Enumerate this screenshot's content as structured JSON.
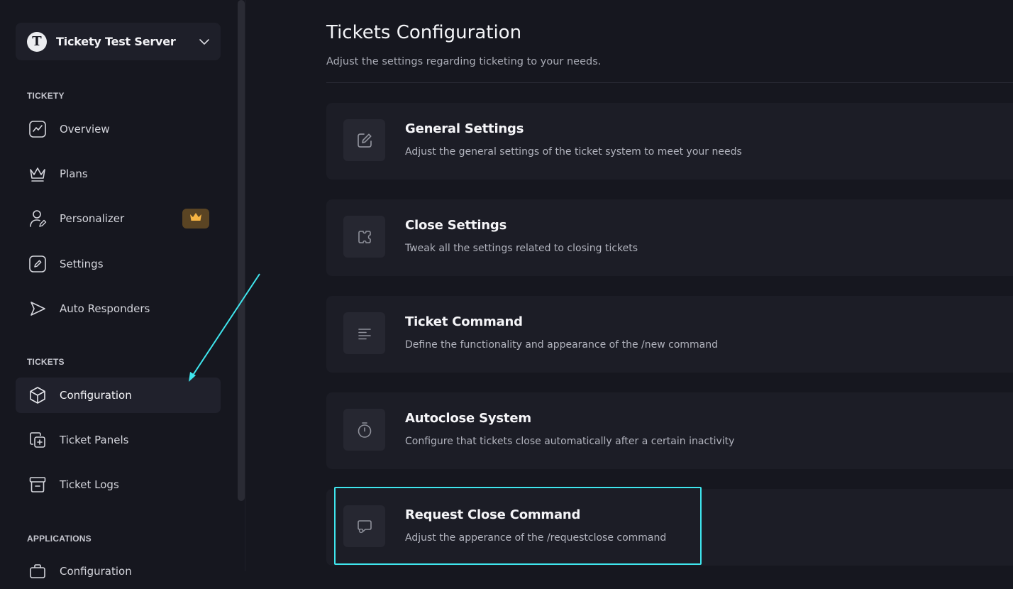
{
  "server": {
    "name": "Tickety Test Server",
    "logo_letter": "T"
  },
  "sections": {
    "tickety": "TICKETY",
    "tickets": "TICKETS",
    "applications": "APPLICATIONS"
  },
  "nav": {
    "overview": "Overview",
    "plans": "Plans",
    "personalizer": "Personalizer",
    "settings": "Settings",
    "auto_responders": "Auto Responders",
    "configuration": "Configuration",
    "ticket_panels": "Ticket Panels",
    "ticket_logs": "Ticket Logs",
    "app_configuration": "Configuration"
  },
  "page": {
    "title": "Tickets Configuration",
    "subtitle": "Adjust the settings regarding ticketing to your needs."
  },
  "cards": [
    {
      "title": "General Settings",
      "desc": "Adjust the general settings of the ticket system to meet your needs",
      "icon": "edit-icon"
    },
    {
      "title": "Close Settings",
      "desc": "Tweak all the settings related to closing tickets",
      "icon": "ticket-icon"
    },
    {
      "title": "Ticket Command",
      "desc": "Define the functionality and appearance of the /new command",
      "icon": "align-left-icon"
    },
    {
      "title": "Autoclose System",
      "desc": "Configure that tickets close automatically after a certain inactivity",
      "icon": "stopwatch-icon"
    },
    {
      "title": "Request Close Command",
      "desc": "Adjust the apperance of the /requestclose command",
      "icon": "chat-bubble-icon"
    }
  ],
  "colors": {
    "background": "#16171f",
    "card": "#1c1d26",
    "accent_highlight": "#3fe6ee",
    "premium": "#f6b443"
  }
}
